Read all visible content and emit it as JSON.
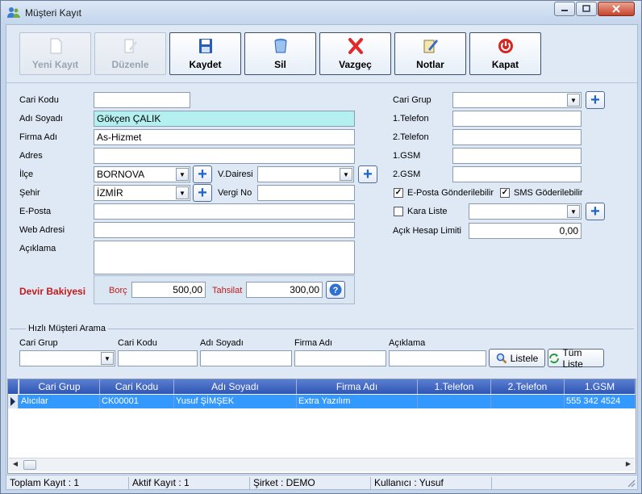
{
  "window": {
    "title": "Müşteri Kayıt"
  },
  "toolbar": {
    "yeni": "Yeni Kayıt",
    "duzenle": "Düzenle",
    "kaydet": "Kaydet",
    "sil": "Sil",
    "vazgec": "Vazgeç",
    "notlar": "Notlar",
    "kapat": "Kapat"
  },
  "form": {
    "cari_kodu": {
      "label": "Cari Kodu",
      "value": ""
    },
    "adi_soyadi": {
      "label": "Adı Soyadı",
      "value": "Gökçen ÇALIK"
    },
    "firma_adi": {
      "label": "Firma Adı",
      "value": "As-Hizmet"
    },
    "adres": {
      "label": "Adres",
      "value": ""
    },
    "ilce": {
      "label": "İlçe",
      "value": "BORNOVA"
    },
    "vdairesi": {
      "label": "V.Dairesi",
      "value": ""
    },
    "sehir": {
      "label": "Şehir",
      "value": "İZMİR"
    },
    "vergi_no": {
      "label": "Vergi No",
      "value": ""
    },
    "eposta": {
      "label": "E-Posta",
      "value": ""
    },
    "web": {
      "label": "Web Adresi",
      "value": ""
    },
    "aciklama": {
      "label": "Açıklama",
      "value": ""
    },
    "cari_grup": {
      "label": "Cari Grup",
      "value": ""
    },
    "tel1": {
      "label": "1.Telefon",
      "value": ""
    },
    "tel2": {
      "label": "2.Telefon",
      "value": ""
    },
    "gsm1": {
      "label": "1.GSM",
      "value": ""
    },
    "gsm2": {
      "label": "2.GSM",
      "value": ""
    },
    "eposta_gonder": {
      "label": "E-Posta Gönderilebilir",
      "checked": true
    },
    "sms_gonder": {
      "label": "SMS Göderilebilir",
      "checked": true
    },
    "kara_liste": {
      "label": "Kara Liste",
      "checked": false,
      "value": ""
    },
    "acik_hesap": {
      "label": "Açık Hesap Limiti",
      "value": "0,00"
    }
  },
  "devir": {
    "label": "Devir Bakiyesi",
    "borc_label": "Borç",
    "borc": "500,00",
    "tahsilat_label": "Tahsilat",
    "tahsilat": "300,00"
  },
  "search": {
    "title": "Hızlı Müşteri Arama",
    "labels": [
      "Cari Grup",
      "Cari Kodu",
      "Adı Soyadı",
      "Firma Adı",
      "Açıklama"
    ],
    "listele": "Listele",
    "tum_liste": "Tüm Liste"
  },
  "grid": {
    "headers": [
      "Cari Grup",
      "Cari Kodu",
      "Adı Soyadı",
      "Firma Adı",
      "1.Telefon",
      "2.Telefon",
      "1.GSM"
    ],
    "rows": [
      [
        "Alıcılar",
        "CK00001",
        "Yusuf ŞİMŞEK",
        "Extra Yazılım",
        "",
        "",
        "555 342 4524"
      ]
    ],
    "selected_color": "#3399ff"
  },
  "status": {
    "toplam": "Toplam Kayıt : 1",
    "aktif": "Aktif Kayıt : 1",
    "sirket": "Şirket : DEMO",
    "kullanici": "Kullanıcı : Yusuf"
  }
}
